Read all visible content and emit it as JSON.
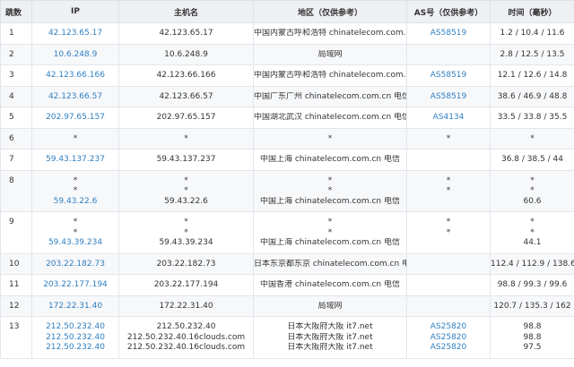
{
  "headers": {
    "hop": "跳数",
    "ip": "IP",
    "host": "主机名",
    "region": "地区（仅供参考）",
    "as": "AS号（仅供参考）",
    "time": "时间（毫秒）"
  },
  "rows": [
    {
      "hop": "1",
      "lines": [
        {
          "ip": "42.123.65.17",
          "host": "42.123.65.17",
          "region": "中国内蒙古呼和浩特 chinatelecom.com.cn 电信",
          "as": "AS58519",
          "time": "1.2 / 10.4 / 11.6"
        }
      ]
    },
    {
      "hop": "2",
      "lines": [
        {
          "ip": "10.6.248.9",
          "host": "10.6.248.9",
          "region": "局域网",
          "as": "",
          "time": "2.8 / 12.5 / 13.5"
        }
      ]
    },
    {
      "hop": "3",
      "lines": [
        {
          "ip": "42.123.66.166",
          "host": "42.123.66.166",
          "region": "中国内蒙古呼和浩特 chinatelecom.com.cn 电信",
          "as": "AS58519",
          "time": "12.1 / 12.6 / 14.8"
        }
      ]
    },
    {
      "hop": "4",
      "lines": [
        {
          "ip": "42.123.66.57",
          "host": "42.123.66.57",
          "region": "中国广东广州 chinatelecom.com.cn 电信",
          "as": "AS58519",
          "time": "38.6 / 46.9 / 48.8"
        }
      ]
    },
    {
      "hop": "5",
      "lines": [
        {
          "ip": "202.97.65.157",
          "host": "202.97.65.157",
          "region": "中国湖北武汉 chinatelecom.com.cn 电信",
          "as": "AS4134",
          "time": "33.5 / 33.8 / 35.5"
        }
      ]
    },
    {
      "hop": "6",
      "lines": [
        {
          "ip": "*",
          "host": "*",
          "region": "*",
          "as": "*",
          "time": "*"
        }
      ]
    },
    {
      "hop": "7",
      "lines": [
        {
          "ip": "59.43.137.237",
          "host": "59.43.137.237",
          "region": "中国上海 chinatelecom.com.cn 电信",
          "as": "",
          "time": "36.8 / 38.5 / 44"
        }
      ]
    },
    {
      "hop": "8",
      "lines": [
        {
          "ip": "*",
          "host": "*",
          "region": "*",
          "as": "*",
          "time": "*"
        },
        {
          "ip": "*",
          "host": "*",
          "region": "*",
          "as": "*",
          "time": "*"
        },
        {
          "ip": "59.43.22.6",
          "host": "59.43.22.6",
          "region": "中国上海 chinatelecom.com.cn 电信",
          "as": "",
          "time": "60.6"
        }
      ]
    },
    {
      "hop": "9",
      "lines": [
        {
          "ip": "*",
          "host": "*",
          "region": "*",
          "as": "*",
          "time": "*"
        },
        {
          "ip": "*",
          "host": "*",
          "region": "*",
          "as": "*",
          "time": "*"
        },
        {
          "ip": "59.43.39.234",
          "host": "59.43.39.234",
          "region": "中国上海 chinatelecom.com.cn 电信",
          "as": "",
          "time": "44.1"
        }
      ]
    },
    {
      "hop": "10",
      "lines": [
        {
          "ip": "203.22.182.73",
          "host": "203.22.182.73",
          "region": "日本东京都东京 chinatelecom.com.cn 电信",
          "as": "",
          "time": "112.4 / 112.9 / 138.6"
        }
      ]
    },
    {
      "hop": "11",
      "lines": [
        {
          "ip": "203.22.177.194",
          "host": "203.22.177.194",
          "region": "中国香港 chinatelecom.com.cn 电信",
          "as": "",
          "time": "98.8 / 99.3 / 99.6"
        }
      ]
    },
    {
      "hop": "12",
      "lines": [
        {
          "ip": "172.22.31.40",
          "host": "172.22.31.40",
          "region": "局域网",
          "as": "",
          "time": "120.7 / 135.3 / 162"
        }
      ]
    },
    {
      "hop": "13",
      "lines": [
        {
          "ip": "212.50.232.40",
          "host": "212.50.232.40",
          "region": "日本大阪府大阪 it7.net",
          "as": "AS25820",
          "time": "98.8"
        },
        {
          "ip": "212.50.232.40",
          "host": "212.50.232.40.16clouds.com",
          "region": "日本大阪府大阪 it7.net",
          "as": "AS25820",
          "time": "98.8"
        },
        {
          "ip": "212.50.232.40",
          "host": "212.50.232.40.16clouds.com",
          "region": "日本大阪府大阪 it7.net",
          "as": "AS25820",
          "time": "97.5"
        }
      ]
    }
  ],
  "colors": {
    "link": "#2f7fc1",
    "header_bg": "#eef0f3",
    "alt_row_bg": "#f7f8fa",
    "border": "#e3e6ea"
  }
}
